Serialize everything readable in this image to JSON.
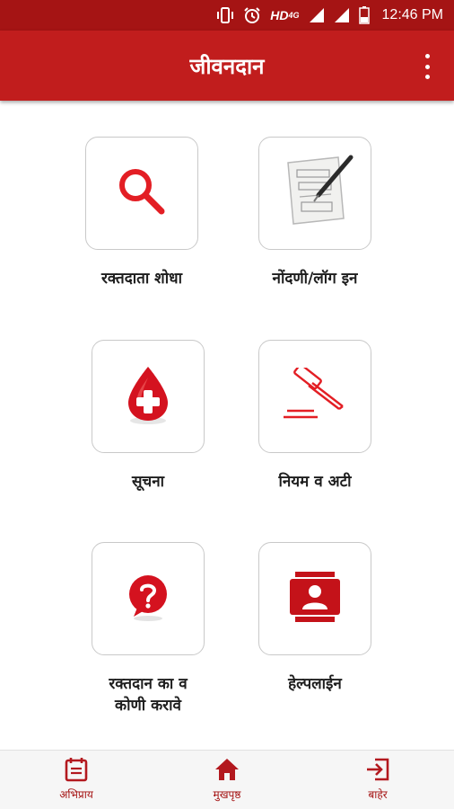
{
  "status_bar": {
    "network_label": "HD",
    "network_type": "4G",
    "time": "12:46 PM",
    "icons": [
      "vibrate-icon",
      "alarm-icon",
      "signal-icon",
      "battery-icon"
    ]
  },
  "app_bar": {
    "title": "जीवनदान",
    "overflow_icon": "more-vert-icon"
  },
  "menu": [
    {
      "lines": [
        "रक्तदाता शोधा"
      ],
      "icon": "search-icon"
    },
    {
      "lines": [
        "नोंदणी/लॉग इन"
      ],
      "icon": "registration-form-icon"
    },
    {
      "lines": [
        "सूचना"
      ],
      "icon": "blood-drop-icon"
    },
    {
      "lines": [
        "नियम व अटी"
      ],
      "icon": "gavel-icon"
    },
    {
      "lines": [
        "रक्तदान का व",
        "कोणी करावे"
      ],
      "icon": "question-bubble-icon"
    },
    {
      "lines": [
        "हेल्पलाईन"
      ],
      "icon": "contact-card-icon"
    }
  ],
  "bottom_nav": [
    {
      "label": "अभिप्राय",
      "icon": "feedback-icon"
    },
    {
      "label": "मुखपृष्ठ",
      "icon": "home-icon"
    },
    {
      "label": "बाहेर",
      "icon": "exit-icon"
    }
  ],
  "colors": {
    "status_bar": "#a51414",
    "app_bar": "#c11d1d",
    "accent": "#e31e24",
    "nav_label": "#a51414"
  }
}
